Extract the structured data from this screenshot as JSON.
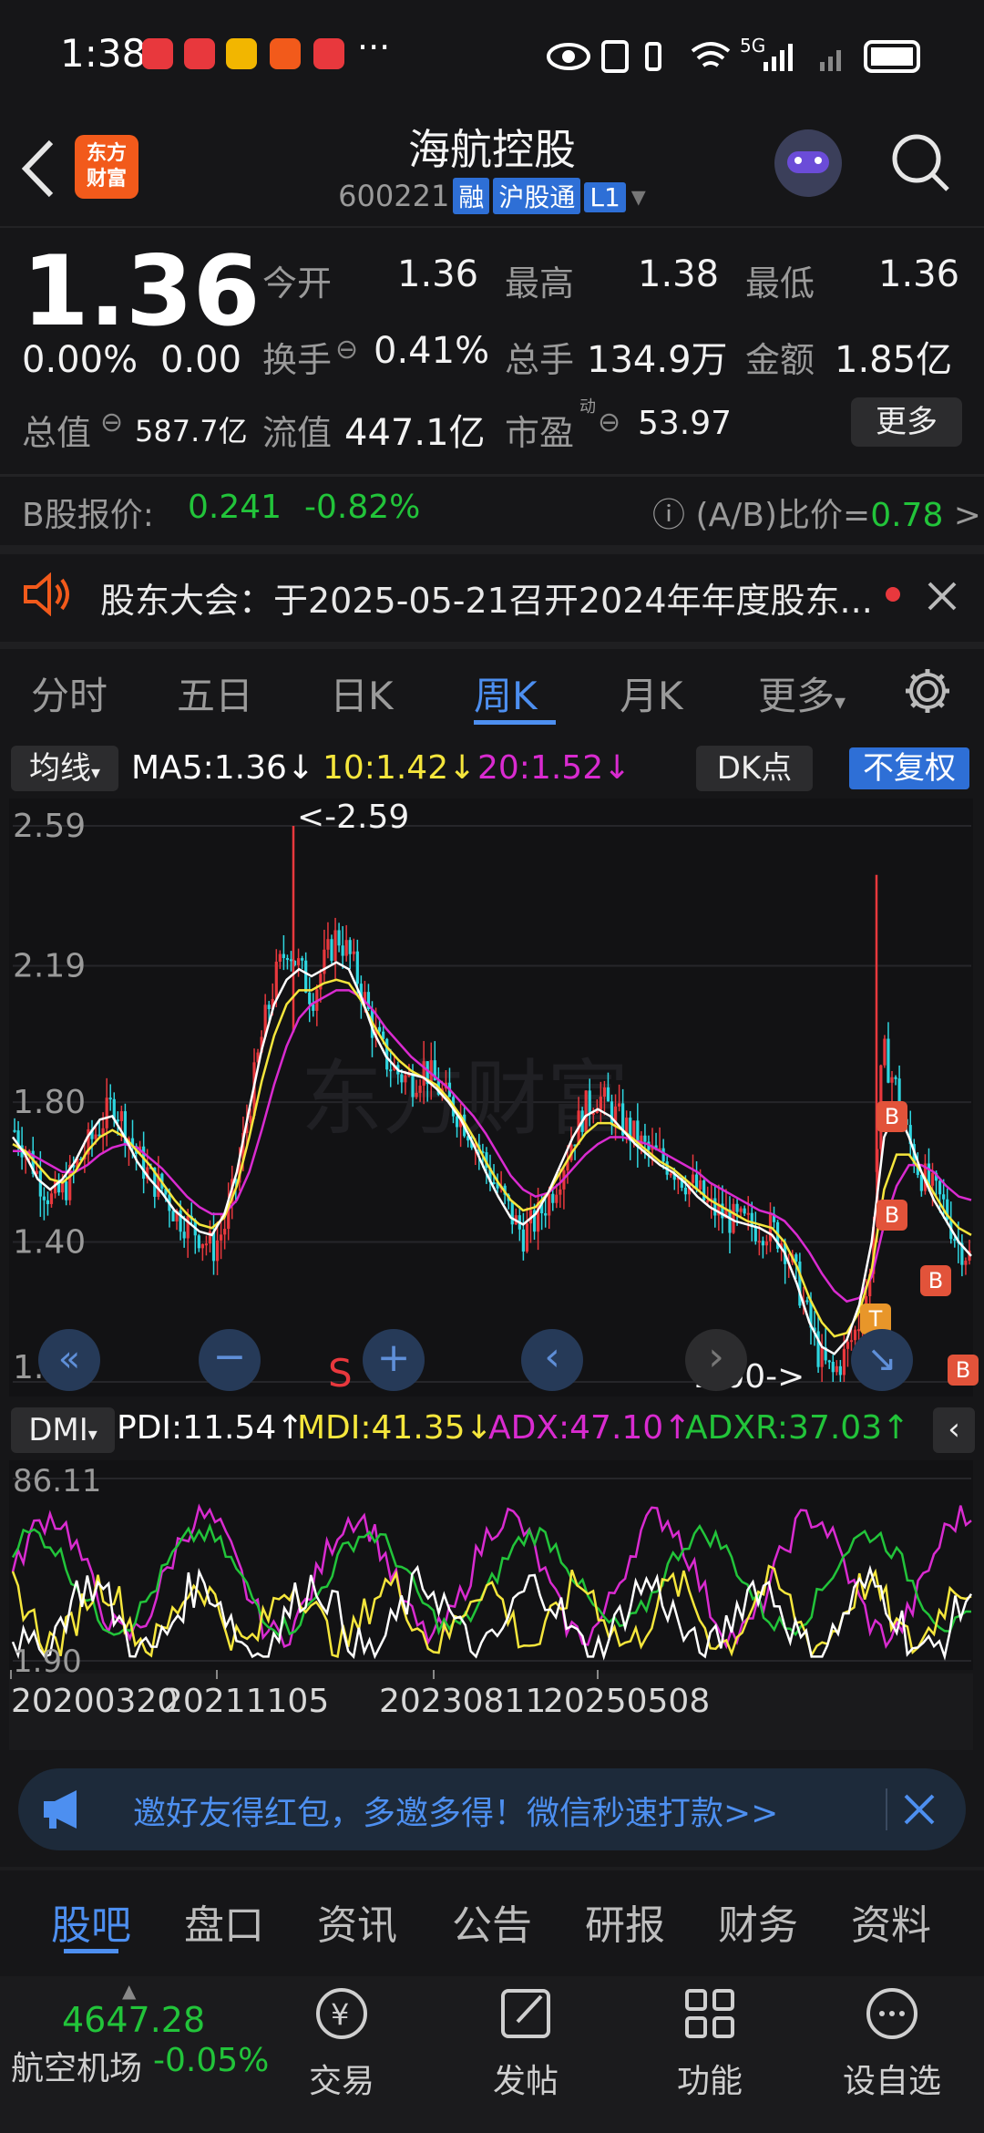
{
  "status_bar": {
    "time": "1:38",
    "signal": "5G",
    "dots": "···"
  },
  "header": {
    "logo_line1": "东方",
    "logo_line2": "财富",
    "title": "海航控股",
    "code": "600221",
    "badges": [
      "融",
      "沪股通",
      "L1"
    ]
  },
  "quote": {
    "price": "1.36",
    "change_pct": "0.00%",
    "change": "0.00",
    "open_label": "今开",
    "open": "1.36",
    "high_label": "最高",
    "high": "1.38",
    "low_label": "最低",
    "low": "1.36",
    "turnover_label": "换手",
    "turnover": "0.41%",
    "volume_label": "总手",
    "volume": "134.9万",
    "amount_label": "金额",
    "amount": "1.85亿",
    "mktcap_label": "总值",
    "mktcap": "587.7亿",
    "float_label": "流值",
    "float": "447.1亿",
    "pe_label": "市盈",
    "pe_sup": "动",
    "pe": "53.97",
    "more": "更多"
  },
  "bshare": {
    "label": "B股报价:",
    "price": "0.241",
    "change": "-0.82%",
    "ratio_label": "(A/B)比价=",
    "ratio": "0.78"
  },
  "notice": {
    "text": "股东大会：于2025-05-21召开2024年年度股东..."
  },
  "period_tabs": [
    "分时",
    "五日",
    "日K",
    "周K",
    "月K",
    "更多"
  ],
  "active_period": "周K",
  "ma_legend": {
    "selector": "均线",
    "ma5": "MA5:1.36↓",
    "ma10": "10:1.42↓",
    "ma20": "20:1.52↓",
    "dk": "DK点",
    "adjust": "不复权"
  },
  "colors": {
    "ma5": "#ffffff",
    "ma10": "#f5e63c",
    "ma20": "#d92bd0",
    "up": "#e8383d",
    "down": "#2ed6e0",
    "accent": "#4d8ff0",
    "adxr": "#22c43a"
  },
  "dmi_legend": {
    "selector": "DMI",
    "pdi": "PDI:11.54↑",
    "mdi": "MDI:41.35↓",
    "adx": "ADX:47.10↑",
    "adxr": "ADXR:37.03↑"
  },
  "chart_controls": {
    "max_annot": "<-2.59",
    "min_annot": "1.00->",
    "s_marker": "S"
  },
  "chart_data": {
    "type": "candlestick",
    "price_axis_labels": [
      "2.59",
      "2.19",
      "1.80",
      "1.40",
      "1.00"
    ],
    "ylim": [
      1.0,
      2.59
    ],
    "dmi_axis_labels": [
      "86.11",
      "1.90"
    ],
    "x_tick_labels": [
      "20200320",
      "20211105",
      "20230811",
      "20250508"
    ],
    "max_price": 2.59,
    "min_price": 1.0,
    "close_path": [
      1.72,
      1.66,
      1.58,
      1.52,
      1.55,
      1.62,
      1.68,
      1.74,
      1.8,
      1.72,
      1.64,
      1.58,
      1.55,
      1.48,
      1.45,
      1.42,
      1.38,
      1.45,
      1.6,
      1.8,
      2.0,
      2.15,
      2.25,
      2.18,
      2.1,
      2.2,
      2.28,
      2.22,
      2.12,
      2.0,
      1.92,
      1.88,
      1.86,
      1.9,
      1.85,
      1.8,
      1.76,
      1.7,
      1.62,
      1.55,
      1.48,
      1.42,
      1.46,
      1.52,
      1.6,
      1.7,
      1.78,
      1.82,
      1.78,
      1.74,
      1.7,
      1.66,
      1.64,
      1.62,
      1.58,
      1.55,
      1.5,
      1.48,
      1.46,
      1.45,
      1.44,
      1.44,
      1.4,
      1.3,
      1.18,
      1.06,
      1.02,
      1.08,
      1.16,
      1.3,
      1.95,
      1.85,
      1.7,
      1.6,
      1.55,
      1.5,
      1.4,
      1.36
    ],
    "ma5": [
      1.7,
      1.65,
      1.58,
      1.55,
      1.58,
      1.63,
      1.7,
      1.75,
      1.76,
      1.7,
      1.63,
      1.58,
      1.54,
      1.49,
      1.46,
      1.43,
      1.42,
      1.48,
      1.6,
      1.78,
      1.95,
      2.08,
      2.15,
      2.18,
      2.16,
      2.18,
      2.2,
      2.18,
      2.1,
      2.0,
      1.93,
      1.89,
      1.88,
      1.87,
      1.84,
      1.8,
      1.75,
      1.68,
      1.6,
      1.53,
      1.47,
      1.45,
      1.48,
      1.54,
      1.62,
      1.7,
      1.76,
      1.78,
      1.76,
      1.72,
      1.68,
      1.65,
      1.62,
      1.6,
      1.57,
      1.53,
      1.5,
      1.48,
      1.46,
      1.45,
      1.44,
      1.42,
      1.37,
      1.28,
      1.17,
      1.1,
      1.08,
      1.12,
      1.22,
      1.4,
      1.7,
      1.78,
      1.7,
      1.6,
      1.52,
      1.46,
      1.4,
      1.36
    ],
    "ma10": [
      1.68,
      1.66,
      1.62,
      1.58,
      1.57,
      1.6,
      1.66,
      1.7,
      1.72,
      1.7,
      1.66,
      1.62,
      1.57,
      1.52,
      1.48,
      1.45,
      1.44,
      1.47,
      1.56,
      1.7,
      1.86,
      1.99,
      2.08,
      2.12,
      2.12,
      2.14,
      2.15,
      2.14,
      2.09,
      2.02,
      1.96,
      1.92,
      1.89,
      1.87,
      1.85,
      1.81,
      1.76,
      1.7,
      1.63,
      1.57,
      1.52,
      1.49,
      1.5,
      1.54,
      1.6,
      1.66,
      1.71,
      1.74,
      1.74,
      1.72,
      1.69,
      1.66,
      1.63,
      1.61,
      1.58,
      1.55,
      1.52,
      1.5,
      1.48,
      1.46,
      1.45,
      1.44,
      1.4,
      1.33,
      1.24,
      1.17,
      1.13,
      1.14,
      1.2,
      1.32,
      1.55,
      1.65,
      1.65,
      1.6,
      1.54,
      1.48,
      1.44,
      1.42
    ],
    "ma20": [
      1.66,
      1.66,
      1.64,
      1.62,
      1.6,
      1.6,
      1.62,
      1.65,
      1.67,
      1.68,
      1.67,
      1.64,
      1.61,
      1.57,
      1.53,
      1.5,
      1.48,
      1.48,
      1.52,
      1.6,
      1.72,
      1.85,
      1.96,
      2.04,
      2.08,
      2.1,
      2.12,
      2.12,
      2.1,
      2.06,
      2.01,
      1.97,
      1.93,
      1.9,
      1.87,
      1.84,
      1.8,
      1.76,
      1.71,
      1.65,
      1.59,
      1.55,
      1.53,
      1.54,
      1.57,
      1.61,
      1.65,
      1.68,
      1.7,
      1.7,
      1.69,
      1.68,
      1.66,
      1.64,
      1.62,
      1.6,
      1.57,
      1.55,
      1.53,
      1.51,
      1.49,
      1.48,
      1.46,
      1.42,
      1.37,
      1.31,
      1.26,
      1.23,
      1.24,
      1.3,
      1.45,
      1.56,
      1.62,
      1.62,
      1.6,
      1.56,
      1.53,
      1.52
    ]
  },
  "invite": {
    "text": "邀好友得红包，多邀多得！微信秒速打款>>"
  },
  "f10_tabs": [
    "股吧",
    "盘口",
    "资讯",
    "公告",
    "研报",
    "财务",
    "资料"
  ],
  "active_f10": "股吧",
  "bottom_nav": {
    "index_value": "4647.28",
    "index_name": "航空机场",
    "index_change": "-0.05%",
    "items": [
      "交易",
      "发帖",
      "功能",
      "设自选"
    ]
  }
}
